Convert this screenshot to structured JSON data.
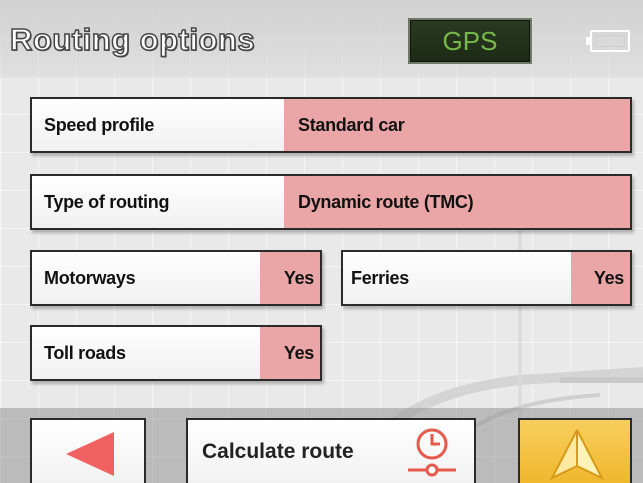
{
  "header": {
    "title": "Routing options",
    "gps_label": "GPS"
  },
  "options": {
    "speed_profile": {
      "label": "Speed profile",
      "value": "Standard car"
    },
    "type_of_routing": {
      "label": "Type of routing",
      "value": "Dynamic route (TMC)"
    },
    "motorways": {
      "label": "Motorways",
      "value": "Yes"
    },
    "ferries": {
      "label": "Ferries",
      "value": "Yes"
    },
    "toll_roads": {
      "label": "Toll roads",
      "value": "Yes"
    }
  },
  "footer": {
    "calculate_label": "Calculate route"
  },
  "colors": {
    "value_bg": "#eaa6a6",
    "back_arrow": "#f06262",
    "nav_button": "#f3c040",
    "gps_text": "#77b94a",
    "route_icon": "#e55a4a"
  },
  "icons": {
    "back": "left-triangle-icon",
    "calculate": "clock-route-icon",
    "navigate": "navigation-arrow-icon",
    "battery": "battery-icon"
  }
}
